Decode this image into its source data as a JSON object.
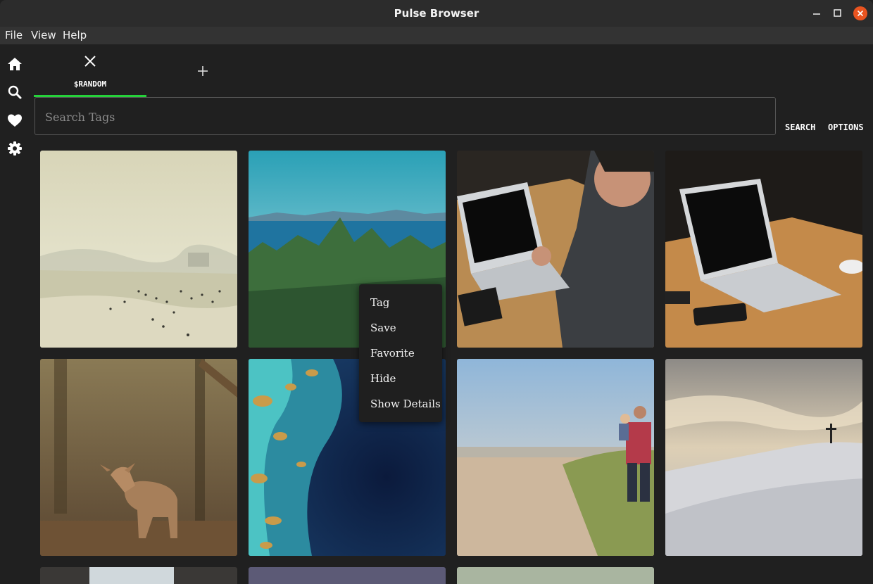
{
  "window": {
    "title": "Pulse Browser",
    "close_color": "#e95420"
  },
  "menu": {
    "file": "File",
    "view": "View",
    "help": "Help"
  },
  "nav": [
    {
      "icon": "home-icon"
    },
    {
      "icon": "search-icon"
    },
    {
      "icon": "heart-icon"
    },
    {
      "icon": "gear-icon"
    }
  ],
  "tabs": [
    {
      "label": "$RANDOM",
      "active": true
    }
  ],
  "accent": "#25d23a",
  "search": {
    "placeholder": "Search Tags",
    "value": ""
  },
  "toolbar": {
    "search_label": "SEARCH",
    "options_label": "OPTIONS"
  },
  "gallery": {
    "images": [
      {
        "subject": "hazy beach with swimmers"
      },
      {
        "subject": "forest and sea with mountains"
      },
      {
        "subject": "man typing on laptop at wooden table"
      },
      {
        "subject": "laptop on wooden table"
      },
      {
        "subject": "young deer in autumn forest"
      },
      {
        "subject": "satellite view of ocean and islands"
      },
      {
        "subject": "man carrying child on beach"
      },
      {
        "subject": "snowy hill with cross at sunset"
      }
    ]
  },
  "context_menu": {
    "items": [
      "Tag",
      "Save",
      "Favorite",
      "Hide",
      "Show Details"
    ]
  }
}
